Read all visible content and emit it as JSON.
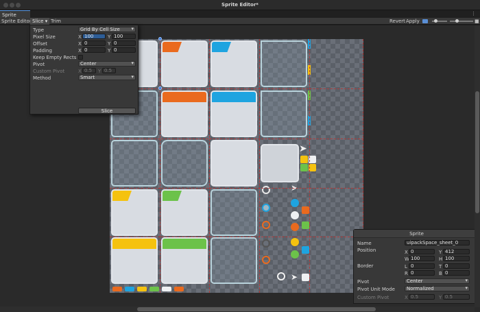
{
  "window": {
    "title": "Sprite Editor*",
    "tab": "Sprite Editor*"
  },
  "toolbar": {
    "mode": "Sprite Editor ▾",
    "slice": "Slice ▾",
    "trim": "Trim",
    "revert": "Revert",
    "apply": "Apply"
  },
  "slice_popup": {
    "type_label": "Type",
    "type_value": "Grid By Cell Size",
    "pixel_size_label": "Pixel Size",
    "pixel_size": {
      "x": "100",
      "y": "100"
    },
    "offset_label": "Offset",
    "offset": {
      "x": "0",
      "y": "0"
    },
    "padding_label": "Padding",
    "padding": {
      "x": "0",
      "y": "0"
    },
    "keep_empty_label": "Keep Empty Rects",
    "pivot_label": "Pivot",
    "pivot_value": "Center",
    "custom_pivot_label": "Custom Pivot",
    "custom_pivot": {
      "x": "0.5",
      "y": "0.5"
    },
    "method_label": "Method",
    "method_value": "Smart",
    "slice_button": "Slice",
    "axis": {
      "x": "X",
      "y": "Y"
    }
  },
  "sprite_panel": {
    "header": "Sprite",
    "name_label": "Name",
    "name_value": "uipackSpace_sheet_0",
    "position_label": "Position",
    "position": {
      "x": "0",
      "y": "412",
      "w": "100",
      "h": "100"
    },
    "border_label": "Border",
    "border": {
      "l": "0",
      "t": "0",
      "r": "0",
      "b": "0"
    },
    "pivot_label": "Pivot",
    "pivot_value": "Center",
    "pivot_unit_label": "Pivot Unit Mode",
    "pivot_unit_value": "Normalized",
    "custom_pivot_label": "Custom Pivot",
    "custom_pivot": {
      "x": "0.5",
      "y": "0.5"
    },
    "axis": {
      "x": "X",
      "y": "Y",
      "w": "W",
      "h": "H",
      "l": "L",
      "t": "T",
      "r": "R",
      "b": "B"
    }
  },
  "colors": {
    "orange": "#ea6a1e",
    "blue": "#1ea4e0",
    "yellow": "#f5c20f",
    "green": "#6cc24a",
    "slice_line": "#b33a3a",
    "panel": "#d8dce2"
  }
}
